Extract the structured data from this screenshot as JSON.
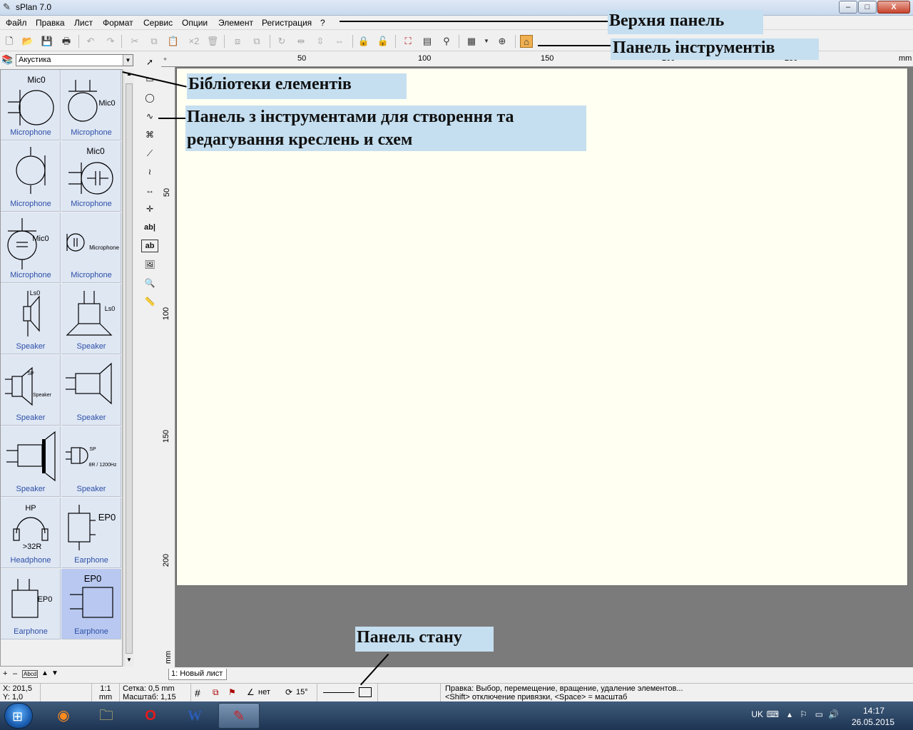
{
  "window": {
    "title": "sPlan 7.0",
    "min": "–",
    "max": "□",
    "close": "X"
  },
  "menu": [
    "Файл",
    "Правка",
    "Лист",
    "Формат",
    "Сервис",
    "Опции",
    "Элемент",
    "Регистрация",
    "?"
  ],
  "toolbar": {
    "icons": [
      "new-icon",
      "open-icon",
      "save-icon",
      "print-icon",
      "undo-icon",
      "redo-icon",
      "cut-icon",
      "copy-icon",
      "paste-icon",
      "duplicate-icon",
      "delete-icon",
      "to-back-icon",
      "to-front-icon",
      "rotate-icon",
      "mirror-h-icon",
      "mirror-v-icon",
      "align-icon",
      "lock-icon",
      "unlock-icon",
      "frame-icon",
      "properties-icon",
      "search-icon",
      "grid-icon",
      "zoom-icon",
      "image-icon"
    ],
    "duplicate_label": "×2"
  },
  "library": {
    "selected": "Акустика",
    "items": [
      {
        "label": "Microphone",
        "tag": "Mic0"
      },
      {
        "label": "Microphone",
        "tag": "Mic0"
      },
      {
        "label": "Microphone",
        "tag": ""
      },
      {
        "label": "Microphone",
        "tag": "Mic0"
      },
      {
        "label": "Microphone",
        "tag": "Mic0"
      },
      {
        "label": "Microphone",
        "tag": "Microphone"
      },
      {
        "label": "Speaker",
        "tag": "Ls0"
      },
      {
        "label": "Speaker",
        "tag": "Ls0"
      },
      {
        "label": "Speaker",
        "tag": "SP",
        "tag2": "Speaker"
      },
      {
        "label": "Speaker",
        "tag": ""
      },
      {
        "label": "Speaker",
        "tag": ""
      },
      {
        "label": "Speaker",
        "tag": "SP",
        "tag2": "8R / 1200Hz"
      },
      {
        "label": "Headphone",
        "tag": "HP",
        "tag2": ">32R"
      },
      {
        "label": "Earphone",
        "tag": "EP0"
      },
      {
        "label": "Earphone",
        "tag": "EP0"
      },
      {
        "label": "Earphone",
        "tag": "EP0"
      }
    ],
    "bottom_controls": [
      "+",
      "–",
      "Abcd",
      "▲",
      "▼"
    ]
  },
  "draw_tools": [
    "select-tool",
    "rectangle-tool",
    "ellipse-tool",
    "freehand-tool",
    "polygon-tool",
    "line-tool",
    "bezier-tool",
    "dimension-tool",
    "node-tool",
    "text-tool",
    "textbox-tool",
    "image-tool",
    "zoom-tool",
    "measure-tool"
  ],
  "draw_tool_text": {
    "text": "ab|",
    "textbox": "ab"
  },
  "ruler": {
    "h_ticks": [
      "50",
      "100",
      "150",
      "200",
      "250"
    ],
    "v_ticks": [
      "50",
      "100",
      "150",
      "200"
    ],
    "unit": "mm"
  },
  "sheet_tab": "1: Новый лист",
  "status": {
    "x": "X: 201,5",
    "y": "Y: 1,0",
    "scale_ratio": "1:1",
    "scale_unit": "mm",
    "grid": "Сетка: 0,5 mm",
    "zoom": "Масштаб:  1,15",
    "angle_mode": "нет",
    "rotation": "15°",
    "hint1": "Правка: Выбор, перемещение, вращение, удаление элементов...",
    "hint2": "<Shift> отключение привязки, <Space> = масштаб"
  },
  "taskbar": {
    "apps": [
      "firefox-icon",
      "explorer-icon",
      "opera-icon",
      "word-icon",
      "splan-icon"
    ],
    "lang": "UK",
    "time": "14:17",
    "date": "26.05.2015"
  },
  "annotations": {
    "top_panel": "Верхня панель",
    "toolbar_panel": "Панель інструментів",
    "libraries": "Бібліотеки елементів",
    "draw_panel_line1": "Панель з інструментами для створення та",
    "draw_panel_line2": "редагування креслень и схем",
    "status_panel": "Панель стану"
  },
  "colors": {
    "sheet": "#fffff2",
    "canvas_bg": "#7b7b7b",
    "annotation_bg": "#c5dff0",
    "library_cell": "#dfe7f3",
    "label_blue": "#2d4fa8"
  }
}
